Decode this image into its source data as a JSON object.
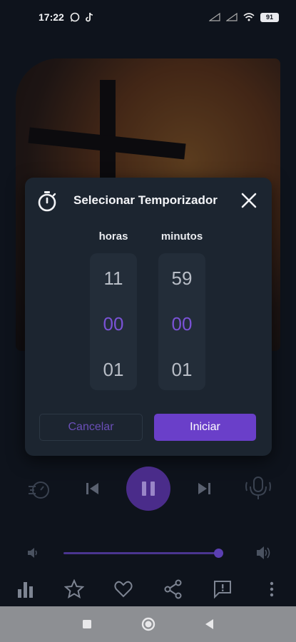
{
  "status_bar": {
    "time": "17:22",
    "battery": "91"
  },
  "dialog": {
    "title": "Selecionar Temporizador",
    "hours_label": "horas",
    "minutes_label": "minutos",
    "hours_values": [
      "11",
      "00",
      "01"
    ],
    "minutes_values": [
      "59",
      "00",
      "01"
    ],
    "cancel_label": "Cancelar",
    "start_label": "Iniciar"
  },
  "player": {
    "volume_level": 0.97
  },
  "colors": {
    "accent": "#6a3fc9",
    "selected_value": "#7a52d6",
    "dialog_bg": "#1c2530"
  },
  "icons": {
    "status": [
      "whatsapp-icon",
      "tiktok-icon",
      "signal-icon",
      "wifi-icon",
      "battery-icon"
    ],
    "controls": [
      "sleep-timer-icon",
      "skip-previous-icon",
      "pause-icon",
      "skip-next-icon",
      "podcast-mic-icon"
    ],
    "actions": [
      "equalizer-icon",
      "star-icon",
      "heart-icon",
      "share-icon",
      "feedback-icon",
      "more-vert-icon"
    ],
    "nav": [
      "recent-apps-icon",
      "home-icon",
      "back-icon"
    ]
  }
}
